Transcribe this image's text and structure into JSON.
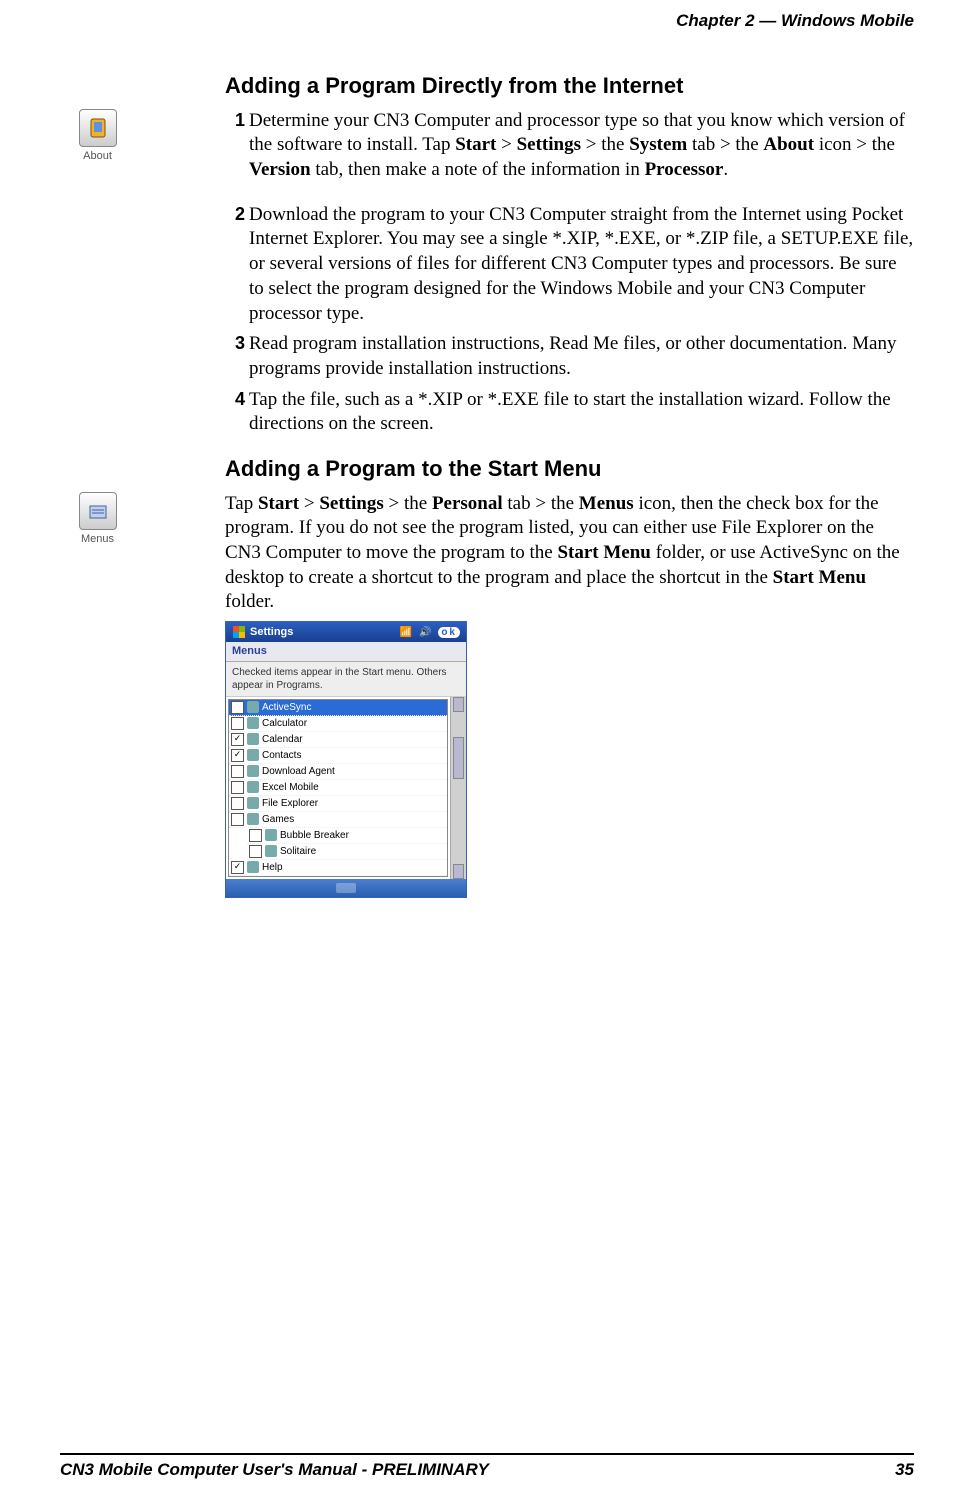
{
  "header": "Chapter 2 —  Windows Mobile",
  "heading1": "Adding a Program Directly from the Internet",
  "icon1_label": "About",
  "step1_num": "1",
  "step1_a": "Determine your CN3 Computer and processor type so that you know which version of the software to install. Tap ",
  "step1_b1": "Start",
  "step1_c1": " > ",
  "step1_b2": "Settings",
  "step1_c2": " > the ",
  "step1_b3": "System",
  "step1_c3": " tab > the ",
  "step1_b4": "About",
  "step1_c4": " icon > the ",
  "step1_b5": "Version",
  "step1_c5": " tab, then make a note of the information in ",
  "step1_b6": "Processor",
  "step1_c6": ".",
  "step2_num": "2",
  "step2": "Download the program to your CN3 Computer straight from the Internet using Pocket Internet Explorer. You may see a single *.XIP, *.EXE, or *.ZIP file, a SETUP.EXE file, or several versions of files for different CN3 Computer types and processors. Be sure to select the program designed for the Windows Mobile and your CN3 Computer processor type.",
  "step3_num": "3",
  "step3": "Read program installation instructions, Read Me files, or other documentation. Many programs provide installation instructions.",
  "step4_num": "4",
  "step4": "Tap the file, such as a *.XIP or *.EXE file to start the installation wizard. Follow the directions on the screen.",
  "heading2": "Adding a Program to the Start Menu",
  "icon2_label": "Menus",
  "para2_a": "Tap ",
  "para2_b1": "Start",
  "para2_c1": " > ",
  "para2_b2": "Settings",
  "para2_c2": " > the ",
  "para2_b3": "Personal",
  "para2_c3": " tab > the ",
  "para2_b4": "Menus",
  "para2_c4": " icon, then the check box for the program. If you do not see the program listed, you can either use File Explorer on the CN3 Computer to move the program to the ",
  "para2_b5": "Start Menu",
  "para2_c5": " folder, or use ActiveSync on the desktop to create a shortcut to the program and place the shortcut in the ",
  "para2_b6": "Start Menu",
  "para2_c6": " folder.",
  "ss": {
    "title": "Settings",
    "ok": "ok",
    "tab": "Menus",
    "instruction": "Checked items appear in the Start menu. Others appear in Programs.",
    "items": [
      {
        "checked": false,
        "label": "ActiveSync",
        "selected": true,
        "indent": 0
      },
      {
        "checked": false,
        "label": "Calculator",
        "selected": false,
        "indent": 0
      },
      {
        "checked": true,
        "label": "Calendar",
        "selected": false,
        "indent": 0
      },
      {
        "checked": true,
        "label": "Contacts",
        "selected": false,
        "indent": 0
      },
      {
        "checked": false,
        "label": "Download Agent",
        "selected": false,
        "indent": 0
      },
      {
        "checked": false,
        "label": "Excel Mobile",
        "selected": false,
        "indent": 0
      },
      {
        "checked": false,
        "label": "File Explorer",
        "selected": false,
        "indent": 0
      },
      {
        "checked": false,
        "label": "Games",
        "selected": false,
        "indent": 0
      },
      {
        "checked": false,
        "label": "Bubble Breaker",
        "selected": false,
        "indent": 1
      },
      {
        "checked": false,
        "label": "Solitaire",
        "selected": false,
        "indent": 1
      },
      {
        "checked": true,
        "label": "Help",
        "selected": false,
        "indent": 0
      }
    ]
  },
  "footer_left": "CN3 Mobile Computer User's Manual - PRELIMINARY",
  "footer_right": "35"
}
